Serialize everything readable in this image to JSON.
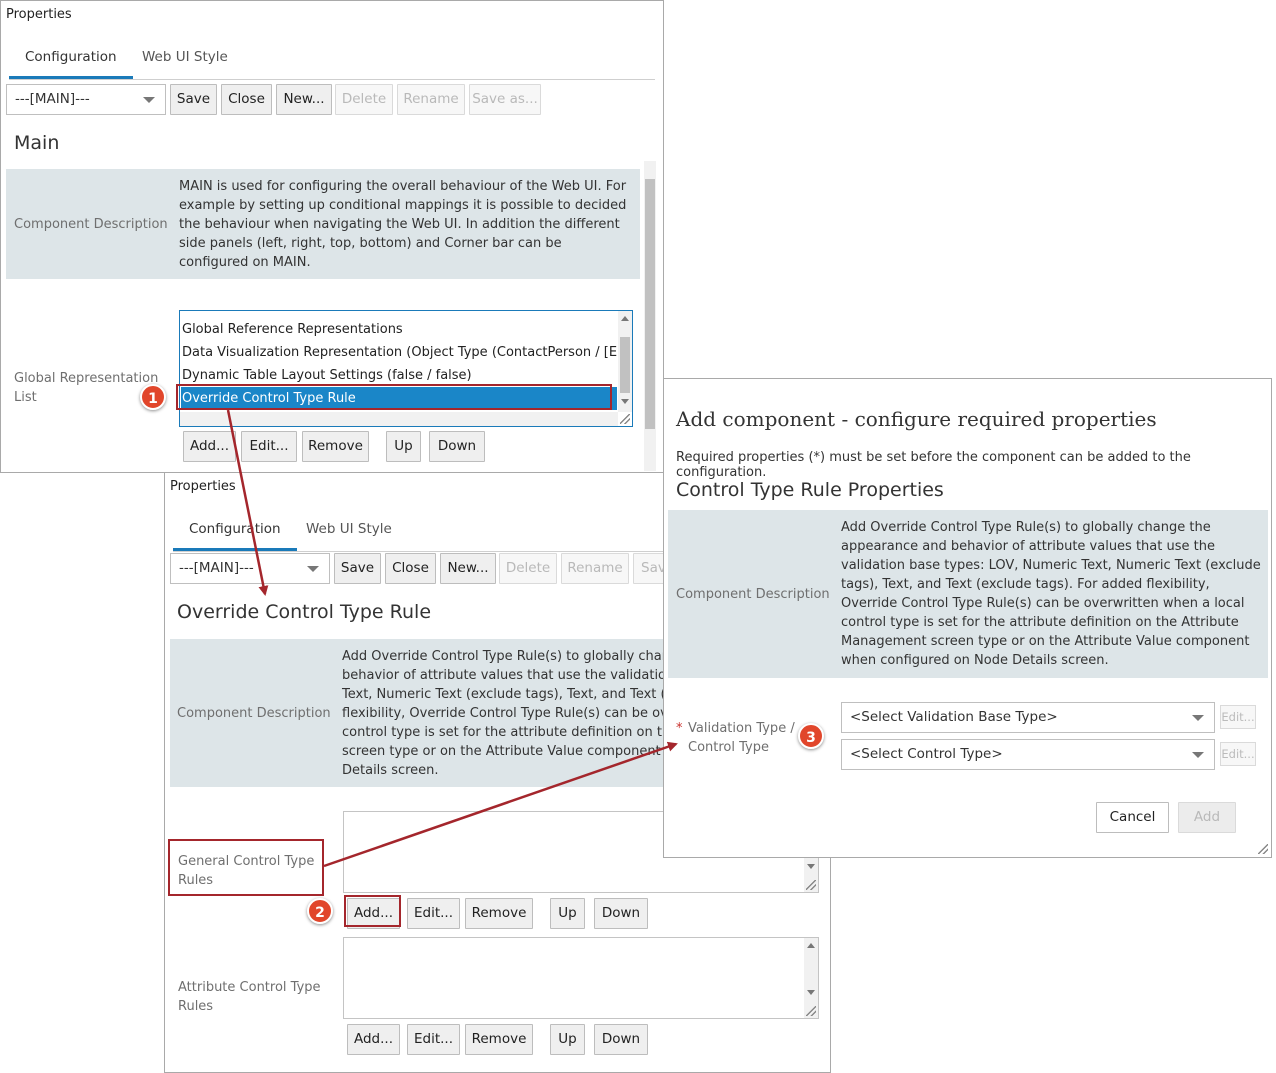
{
  "panel1": {
    "title": "Properties",
    "tabs": [
      {
        "label": "Configuration"
      },
      {
        "label": "Web UI Style"
      }
    ],
    "config_select": "---[MAIN]---",
    "buttons": {
      "save": "Save",
      "close": "Close",
      "new": "New...",
      "delete": "Delete",
      "rename": "Rename",
      "save_as": "Save as..."
    },
    "section_title": "Main",
    "component_description_label": "Component Description",
    "component_description": "MAIN is used for configuring the overall behaviour of the Web UI. For example by setting up conditional mappings it is possible to decided the behaviour when navigating the Web UI. In addition the different side panels (left, right, top, bottom) and Corner bar can be configured on MAIN.",
    "global_rep_label": "Global Representation List",
    "global_rep_items": [
      "Global Reference Representations",
      "Data Visualization Representation (Object Type (ContactPerson / [Entity",
      "Dynamic Table Layout Settings (false / false)",
      "Override Control Type Rule"
    ],
    "list_buttons": {
      "add": "Add...",
      "edit": "Edit...",
      "remove": "Remove",
      "up": "Up",
      "down": "Down"
    }
  },
  "panel2": {
    "title": "Properties",
    "tabs": [
      {
        "label": "Configuration"
      },
      {
        "label": "Web UI Style"
      }
    ],
    "config_select": "---[MAIN]---",
    "buttons": {
      "save": "Save",
      "close": "Close",
      "new": "New...",
      "delete": "Delete",
      "rename": "Rename",
      "save_as": "Sav"
    },
    "section_title": "Override Control Type Rule",
    "component_description_label": "Component Description",
    "component_description_lines": [
      "Add Override Control Type Rule(s) to globally chang",
      "behavior of attribute values that use the validation b",
      "Text, Numeric Text (exclude tags), Text, and Text (exc",
      "flexibility, Override Control Type Rule(s) can be over",
      "control type is set for the attribute definition on the",
      "screen type or on the Attribute Value component w",
      "Details screen."
    ],
    "general_rules_label": "General Control Type Rules",
    "attribute_rules_label": "Attribute Control Type Rules",
    "list_buttons": {
      "add": "Add...",
      "edit": "Edit...",
      "remove": "Remove",
      "up": "Up",
      "down": "Down"
    }
  },
  "dialog": {
    "title": "Add component - configure required properties",
    "subtitle": "Required properties (*) must be set before the component can be added to the configuration.",
    "section_title": "Control Type Rule Properties",
    "component_description_label": "Component Description",
    "component_description": "Add Override Control Type Rule(s) to globally change the appearance and behavior of attribute values that use the validation base types: LOV, Numeric Text, Numeric Text (exclude tags), Text, and Text (exclude tags). For added flexibility, Override Control Type Rule(s) can be overwritten when a local control type is set for the attribute definition on the Attribute Management screen type or on the Attribute Value component when configured on Node Details screen.",
    "required_marker": "*",
    "validation_label": "Validation Type / Control Type",
    "validation_select": "<Select Validation Base Type>",
    "control_select": "<Select Control Type>",
    "edit_label": "Edit...",
    "cancel": "Cancel",
    "add": "Add"
  },
  "callouts": [
    "1",
    "2",
    "3"
  ],
  "colors": {
    "accent": "#1a7ab9",
    "highlight": "#a4262c",
    "badge": "#e1462b",
    "desc_bg": "#dde5e8"
  }
}
